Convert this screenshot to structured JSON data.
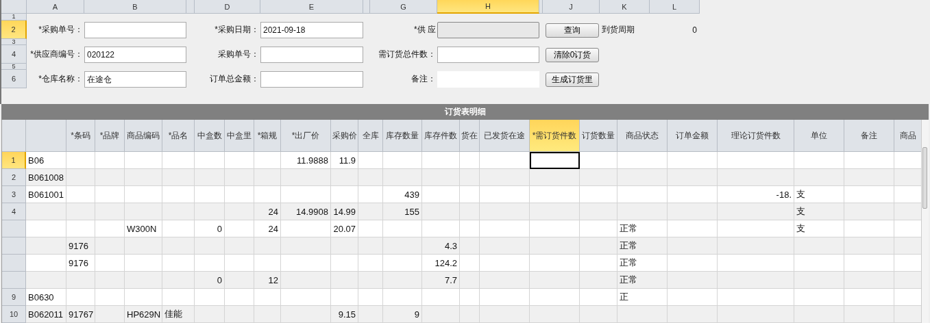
{
  "sheet": {
    "columns": [
      {
        "label": "A",
        "selected": false
      },
      {
        "label": "B",
        "selected": false
      },
      {
        "selected": false
      },
      {
        "label": "D",
        "selected": false
      },
      {
        "label": "E",
        "selected": false
      },
      {
        "selected": false
      },
      {
        "label": "G",
        "selected": false
      },
      {
        "label": "H",
        "selected": true
      },
      {
        "selected": false
      },
      {
        "label": "J",
        "selected": false
      },
      {
        "label": "K",
        "selected": false
      },
      {
        "label": "L",
        "selected": false
      }
    ],
    "rows": [
      {
        "label": "1",
        "selected": false
      },
      {
        "label": "2",
        "selected": true
      },
      {
        "label": "3",
        "selected": false
      },
      {
        "label": "4",
        "selected": false
      },
      {
        "label": "5",
        "selected": false
      },
      {
        "label": "6",
        "selected": false
      }
    ]
  },
  "form_rows": [
    {
      "fields": [
        {
          "label": "*采购单号：",
          "kind": "input"
        },
        {
          "label": "*采购日期：",
          "kind": "input",
          "value": "2021-09-18"
        },
        {
          "label": "*供 应",
          "kind": "dropdown"
        }
      ],
      "button": "查询",
      "extras": [
        "到货周期",
        "0"
      ]
    },
    {
      "fields": [
        {
          "label": "*供应商编号：",
          "kind": "input",
          "value": "020122"
        },
        {
          "label": "采购单号：",
          "kind": "input"
        },
        {
          "label": "需订货总件数：",
          "kind": "input"
        }
      ],
      "button": "清除0订货"
    },
    {
      "fields": [
        {
          "label": "*仓库名称：",
          "kind": "input",
          "value": "在途仓"
        },
        {
          "label": "订单总金额：",
          "kind": "input"
        },
        {
          "label": "备注：",
          "kind": "plain"
        }
      ],
      "button": "生成订货里"
    }
  ],
  "grid": {
    "title": "订货表明细",
    "columns": [
      {
        "selected": false
      },
      {
        "label": "*条码",
        "selected": false
      },
      {
        "label": "*品牌",
        "selected": false
      },
      {
        "label": "商品编码",
        "selected": false
      },
      {
        "label": "*品名",
        "selected": false
      },
      {
        "label": "中盒数",
        "selected": false
      },
      {
        "label": "中盒里",
        "selected": false
      },
      {
        "label": "*箱规",
        "selected": false
      },
      {
        "label": "*出厂价",
        "selected": false
      },
      {
        "label": "采购价",
        "selected": false
      },
      {
        "label": "全库",
        "selected": false
      },
      {
        "label": "库存数量",
        "selected": false
      },
      {
        "label": "库存件数",
        "selected": false
      },
      {
        "label": "货在",
        "selected": false
      },
      {
        "label": "已发货在途",
        "selected": false
      },
      {
        "label": "*需订货件数",
        "selected": true
      },
      {
        "label": "订货数量",
        "selected": false
      },
      {
        "label": "商品状态",
        "selected": false
      },
      {
        "label": "订单金额",
        "selected": false
      },
      {
        "label": "理论订货件数",
        "selected": false
      },
      {
        "label": "单位",
        "selected": false
      },
      {
        "label": "备注",
        "selected": false
      },
      {
        "label": "商品",
        "selected": false
      }
    ],
    "rows": [
      {
        "label": "1",
        "selected": true,
        "cells": [
          "B06",
          null,
          null,
          null,
          null,
          null,
          null,
          null,
          "11.9888",
          "11.9",
          null,
          null,
          null,
          null,
          null,
          null,
          null,
          null,
          null,
          null,
          null,
          null,
          null
        ]
      },
      {
        "label": "2",
        "selected": false,
        "cells": [
          "B061008",
          null,
          null,
          null,
          null,
          null,
          null,
          null,
          null,
          null,
          null,
          null,
          null,
          null,
          null,
          null,
          null,
          null,
          null,
          null,
          null,
          null,
          null
        ]
      },
      {
        "label": "3",
        "selected": false,
        "cells": [
          "B061001",
          null,
          null,
          null,
          null,
          null,
          null,
          null,
          null,
          null,
          null,
          "439",
          null,
          null,
          null,
          null,
          null,
          null,
          null,
          "-18.",
          "支",
          null,
          null
        ]
      },
      {
        "label": "4",
        "selected": false,
        "cells": [
          null,
          null,
          null,
          null,
          null,
          null,
          null,
          "24",
          "14.9908",
          "14.99",
          null,
          "155",
          null,
          null,
          null,
          null,
          null,
          null,
          null,
          null,
          "支",
          null,
          null
        ]
      },
      {
        "selected": false,
        "cells": [
          null,
          null,
          null,
          "W300N",
          null,
          "0",
          null,
          "24",
          null,
          "20.07",
          null,
          null,
          null,
          null,
          null,
          null,
          null,
          "正常",
          null,
          null,
          "支",
          null,
          null
        ]
      },
      {
        "selected": false,
        "cells": [
          null,
          "9176",
          null,
          null,
          null,
          null,
          null,
          null,
          null,
          null,
          null,
          null,
          "4.3",
          null,
          null,
          null,
          null,
          "正常",
          null,
          null,
          null,
          null,
          null
        ]
      },
      {
        "selected": false,
        "cells": [
          null,
          "9176",
          null,
          null,
          null,
          null,
          null,
          null,
          null,
          null,
          null,
          null,
          "124.2",
          null,
          null,
          null,
          null,
          "正常",
          null,
          null,
          null,
          null,
          null
        ]
      },
      {
        "selected": false,
        "cells": [
          null,
          null,
          null,
          null,
          null,
          "0",
          null,
          "12",
          null,
          null,
          null,
          null,
          "7.7",
          null,
          null,
          null,
          null,
          "正常",
          null,
          null,
          null,
          null,
          null
        ]
      },
      {
        "label": "9",
        "selected": false,
        "cells": [
          "B0630",
          null,
          null,
          null,
          null,
          null,
          null,
          null,
          null,
          null,
          null,
          null,
          null,
          null,
          null,
          null,
          null,
          "正",
          null,
          null,
          null,
          null,
          null
        ]
      },
      {
        "label": "10",
        "selected": false,
        "cells": [
          "B062011",
          "91767",
          null,
          "HP629N",
          "佳能",
          null,
          null,
          null,
          null,
          "9.15",
          null,
          "9",
          null,
          null,
          null,
          null,
          null,
          null,
          null,
          null,
          null,
          null,
          null
        ]
      }
    ]
  }
}
